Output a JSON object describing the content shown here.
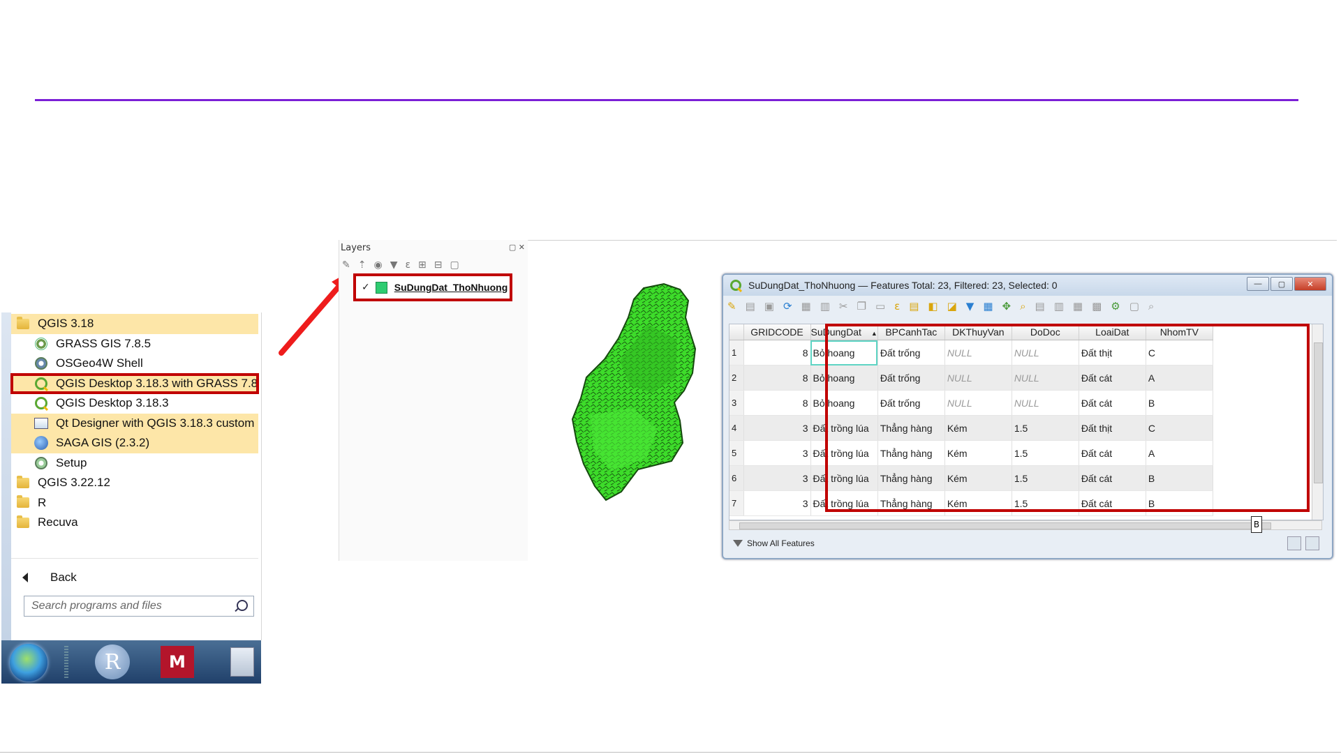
{
  "start_menu": {
    "items": [
      {
        "label": "QGIS 3.18",
        "icon": "folder-icon",
        "level": 0,
        "highlight": true
      },
      {
        "label": "GRASS GIS 7.8.5",
        "icon": "grass-icon",
        "level": 1,
        "highlight": false
      },
      {
        "label": "OSGeo4W Shell",
        "icon": "osgeo-icon",
        "level": 1,
        "highlight": false
      },
      {
        "label": "QGIS Desktop 3.18.3 with GRASS 7.8.",
        "icon": "qgis-icon",
        "level": 1,
        "highlight": true,
        "selected": true
      },
      {
        "label": "QGIS Desktop 3.18.3",
        "icon": "qgis-icon",
        "level": 1,
        "highlight": false
      },
      {
        "label": "Qt Designer with QGIS 3.18.3 custom",
        "icon": "qt-designer-icon",
        "level": 1,
        "highlight": true
      },
      {
        "label": "SAGA GIS (2.3.2)",
        "icon": "saga-icon",
        "level": 1,
        "highlight": true
      },
      {
        "label": "Setup",
        "icon": "setup-icon",
        "level": 1,
        "highlight": false
      },
      {
        "label": "QGIS 3.22.12",
        "icon": "folder-icon",
        "level": 0,
        "highlight": false
      },
      {
        "label": "R",
        "icon": "folder-icon",
        "level": 0,
        "highlight": false
      },
      {
        "label": "Recuva",
        "icon": "folder-icon",
        "level": 0,
        "highlight": false
      }
    ],
    "back_label": "Back",
    "search_placeholder": "Search programs and files"
  },
  "taskbar": {
    "r_label": "R",
    "mendeley_label": "M"
  },
  "layers_panel": {
    "title": "Layers",
    "controls": "▢ ✕",
    "layer_name": "SuDungDat_ThoNhuong",
    "layer_color": "#2ecc71"
  },
  "attribute_table": {
    "title": "SuDungDat_ThoNhuong — Features Total: 23, Filtered: 23, Selected: 0",
    "columns": [
      "GRIDCODE",
      "SuDungDat",
      "BPCanhTac",
      "DKThuyVan",
      "DoDoc",
      "LoaiDat",
      "NhomTV"
    ],
    "sort_indicator": "▲",
    "rows": [
      {
        "n": "1",
        "cells": [
          "8",
          "Bỏ hoang",
          "Đất trống",
          "NULL",
          "NULL",
          "Đất thịt",
          "C"
        ]
      },
      {
        "n": "2",
        "cells": [
          "8",
          "Bỏ hoang",
          "Đất trống",
          "NULL",
          "NULL",
          "Đất cát",
          "A"
        ]
      },
      {
        "n": "3",
        "cells": [
          "8",
          "Bỏ hoang",
          "Đất trống",
          "NULL",
          "NULL",
          "Đất cát",
          "B"
        ]
      },
      {
        "n": "4",
        "cells": [
          "3",
          "Đất trồng lúa",
          "Thẳng hàng",
          "Kém",
          "1.5",
          "Đất thịt",
          "C"
        ]
      },
      {
        "n": "5",
        "cells": [
          "3",
          "Đất trồng lúa",
          "Thẳng hàng",
          "Kém",
          "1.5",
          "Đất cát",
          "A"
        ]
      },
      {
        "n": "6",
        "cells": [
          "3",
          "Đất trồng lúa",
          "Thẳng hàng",
          "Kém",
          "1.5",
          "Đất cát",
          "B"
        ]
      },
      {
        "n": "7",
        "cells": [
          "3",
          "Đất trồng lúa",
          "Thẳng hàng",
          "Kém",
          "1.5",
          "Đất cát",
          "B"
        ]
      }
    ],
    "tooltip_value": "B",
    "footer_label": "Show All Features"
  },
  "colors": {
    "accent_line": "#7b1fd6",
    "highlight_border": "#c00000",
    "menu_highlight": "#fde6a8",
    "map_fill": "#3ddc2a"
  }
}
